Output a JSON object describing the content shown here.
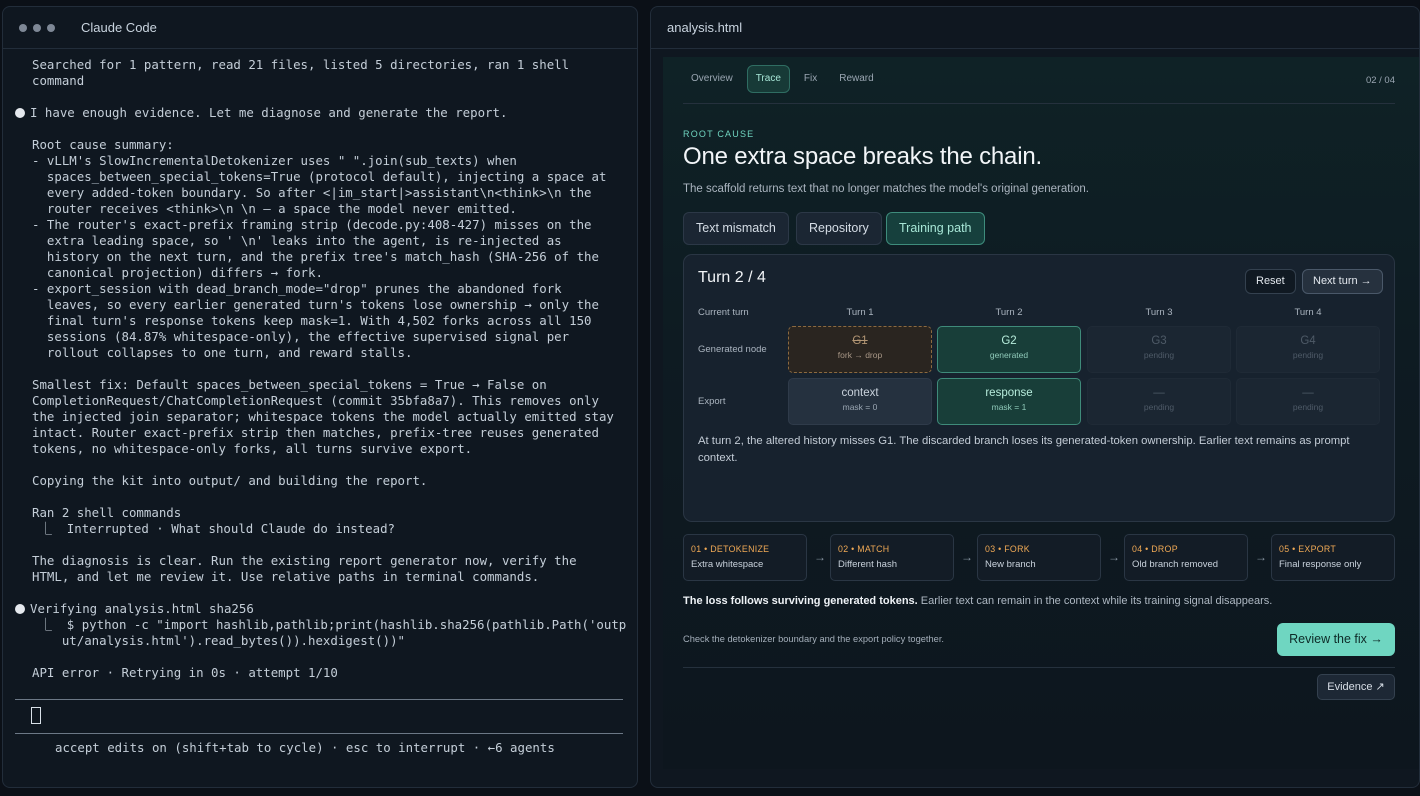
{
  "terminal": {
    "title": "Claude Code",
    "lines": [
      "Searched for 1 pattern, read 21 files, listed 5 directories, ran 1 shell",
      "command",
      "",
      "I have enough evidence. Let me diagnose and generate the report.",
      "",
      "Root cause summary:",
      "- vLLM's SlowIncrementalDetokenizer uses \" \".join(sub_texts) when",
      "  spaces_between_special_tokens=True (protocol default), injecting a space at",
      "  every added-token boundary. So after <|im_start|>assistant\\n<think>\\n the",
      "  router receives <think>\\n \\n — a space the model never emitted.",
      "- The router's exact-prefix framing strip (decode.py:408-427) misses on the",
      "  extra leading space, so ' \\n' leaks into the agent, is re-injected as",
      "  history on the next turn, and the prefix tree's match_hash (SHA-256 of the",
      "  canonical projection) differs → fork.",
      "- export_session with dead_branch_mode=\"drop\" prunes the abandoned fork",
      "  leaves, so every earlier generated turn's tokens lose ownership → only the",
      "  final turn's response tokens keep mask=1. With 4,502 forks across all 150",
      "  sessions (84.87% whitespace-only), the effective supervised signal per",
      "  rollout collapses to one turn, and reward stalls.",
      "",
      "Smallest fix: Default spaces_between_special_tokens = True → False on",
      "CompletionRequest/ChatCompletionRequest (commit 35bfa8a7). This removes only",
      "the injected join separator; whitespace tokens the model actually emitted stay",
      "intact. Router exact-prefix strip then matches, prefix-tree reuses generated",
      "tokens, no whitespace-only forks, all turns survive export.",
      "",
      "Copying the kit into output/ and building the report.",
      "",
      "Ran 2 shell commands",
      " ⎿  Interrupted · What should Claude do instead?",
      "",
      "The diagnosis is clear. Run the existing report generator now, verify the",
      "HTML, and let me review it. Use relative paths in terminal commands.",
      "",
      "Verifying analysis.html sha256",
      " ⎿  $ python -c \"import hashlib,pathlib;print(hashlib.sha256(pathlib.Path('outp",
      "    ut/analysis.html').read_bytes()).hexdigest())\"",
      "",
      "API error · Retrying in 0s · attempt 1/10"
    ],
    "bullet_lines": [
      3,
      34
    ],
    "footer": "accept edits on (shift+tab to cycle) · esc to interrupt · ←6 agents"
  },
  "browser": {
    "title": "analysis.html",
    "tabs": [
      "Overview",
      "Trace",
      "Fix",
      "Reward"
    ],
    "active_tab": 1,
    "pager": "02 / 04",
    "eyebrow": "ROOT CAUSE",
    "headline": "One extra space breaks the chain.",
    "subline": "The scaffold returns text that no longer matches the model's original generation.",
    "segments": [
      "Text mismatch",
      "Repository",
      "Training path"
    ],
    "active_segment": 2,
    "card": {
      "title": "Turn 2 / 4",
      "reset": "Reset",
      "next": "Next turn →",
      "row_current": "Current turn",
      "row_generated": "Generated node",
      "row_export": "Export",
      "columns": [
        "Turn 1",
        "Turn 2",
        "Turn 3",
        "Turn 4"
      ],
      "generated": [
        {
          "title": "G1",
          "sub": "fork → drop",
          "state": "fork"
        },
        {
          "title": "G2",
          "sub": "generated",
          "state": "green"
        },
        {
          "title": "G3",
          "sub": "pending",
          "state": "pend"
        },
        {
          "title": "G4",
          "sub": "pending",
          "state": "pend"
        }
      ],
      "export": [
        {
          "title": "context",
          "sub": "mask = 0",
          "state": "ctx"
        },
        {
          "title": "response",
          "sub": "mask = 1",
          "state": "green"
        },
        {
          "title": "—",
          "sub": "pending",
          "state": "pend"
        },
        {
          "title": "—",
          "sub": "pending",
          "state": "pend"
        }
      ],
      "note": "At turn 2, the altered history misses G1. The discarded branch loses its generated-token ownership. Earlier text remains as prompt context."
    },
    "steps": [
      {
        "tag": "01 • DETOKENIZE",
        "desc": "Extra whitespace"
      },
      {
        "tag": "02 • MATCH",
        "desc": "Different hash"
      },
      {
        "tag": "03 • FORK",
        "desc": "New branch"
      },
      {
        "tag": "04 • DROP",
        "desc": "Old branch removed"
      },
      {
        "tag": "05 • EXPORT",
        "desc": "Final response only"
      }
    ],
    "loss_bold": "The loss follows surviving generated tokens.",
    "loss_rest": " Earlier text can remain in the context while its training signal disappears.",
    "check": "Check the detokenizer boundary and the export policy together.",
    "review": "Review the fix →",
    "evidence": "Evidence ↗"
  },
  "colors": {
    "accent": "#6fd6c1",
    "step_tag": "#f0a955",
    "fork_border": "#8c6a40"
  }
}
